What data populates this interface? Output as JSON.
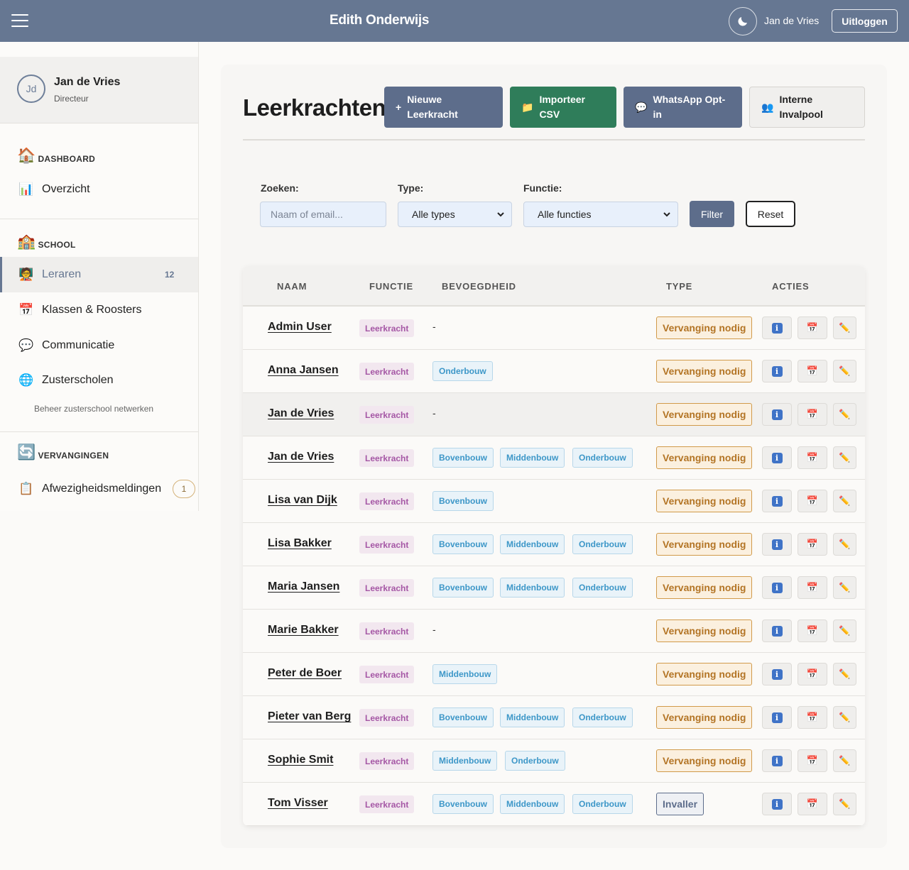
{
  "header": {
    "brand": "Edith Onderwijs",
    "user": "Jan de Vries",
    "logout": "Uitloggen"
  },
  "sidebar": {
    "profile": {
      "initials": "Jd",
      "name": "Jan de Vries",
      "role": "Directeur"
    },
    "sections": {
      "dashboard": "DASHBOARD",
      "school": "SCHOOL",
      "vervangingen": "VERVANGINGEN"
    },
    "items": {
      "overzicht": "Overzicht",
      "leraren": "Leraren",
      "leraren_count": "12",
      "klassen": "Klassen & Roosters",
      "communicatie": "Communicatie",
      "zusterscholen": "Zusterscholen",
      "zusterscholen_sub": "Beheer zusterschool netwerken",
      "afwezigheid": "Afwezigheidsmeldingen",
      "afwezigheid_count": "1"
    }
  },
  "main": {
    "title": "Leerkrachten",
    "actions": {
      "new_teacher": "Nieuwe Leerkracht",
      "import_csv": "Importeer CSV",
      "whatsapp": "WhatsApp Opt-in",
      "invalpool": "Interne Invalpool"
    },
    "filters": {
      "search_label": "Zoeken:",
      "search_placeholder": "Naam of email...",
      "type_label": "Type:",
      "type_value": "Alle types",
      "function_label": "Functie:",
      "function_value": "Alle functies",
      "filter_button": "Filter",
      "reset_button": "Reset"
    },
    "table": {
      "columns": [
        "NAAM",
        "FUNCTIE",
        "BEVOEGDHEID",
        "TYPE",
        "ACTIES"
      ],
      "rows": [
        {
          "name": "Admin User",
          "function": "Leerkracht",
          "qualifications": [],
          "type": "Vervanging nodig"
        },
        {
          "name": "Anna Jansen",
          "function": "Leerkracht",
          "qualifications": [
            "Onderbouw"
          ],
          "type": "Vervanging nodig"
        },
        {
          "name": "Jan de Vries",
          "function": "Leerkracht",
          "qualifications": [],
          "type": "Vervanging nodig"
        },
        {
          "name": "Jan de Vries",
          "function": "Leerkracht",
          "qualifications": [
            "Bovenbouw",
            "Middenbouw",
            "Onderbouw"
          ],
          "type": "Vervanging nodig"
        },
        {
          "name": "Lisa van Dijk",
          "function": "Leerkracht",
          "qualifications": [
            "Bovenbouw"
          ],
          "type": "Vervanging nodig"
        },
        {
          "name": "Lisa Bakker",
          "function": "Leerkracht",
          "qualifications": [
            "Bovenbouw",
            "Middenbouw",
            "Onderbouw"
          ],
          "type": "Vervanging nodig"
        },
        {
          "name": "Maria Jansen",
          "function": "Leerkracht",
          "qualifications": [
            "Bovenbouw",
            "Middenbouw",
            "Onderbouw"
          ],
          "type": "Vervanging nodig"
        },
        {
          "name": "Marie Bakker",
          "function": "Leerkracht",
          "qualifications": [],
          "type": "Vervanging nodig"
        },
        {
          "name": "Peter de Boer",
          "function": "Leerkracht",
          "qualifications": [
            "Middenbouw"
          ],
          "type": "Vervanging nodig"
        },
        {
          "name": "Pieter van Berg",
          "function": "Leerkracht",
          "qualifications": [
            "Bovenbouw",
            "Middenbouw",
            "Onderbouw"
          ],
          "type": "Vervanging nodig"
        },
        {
          "name": "Sophie Smit",
          "function": "Leerkracht",
          "qualifications": [
            "Middenbouw",
            "Onderbouw"
          ],
          "type": "Vervanging nodig"
        },
        {
          "name": "Tom Visser",
          "function": "Leerkracht",
          "qualifications": [
            "Bovenbouw",
            "Middenbouw",
            "Onderbouw"
          ],
          "type": "Invaller"
        }
      ],
      "empty_qualification": "-"
    }
  },
  "colors": {
    "header_bg": "#667792",
    "primary": "#5d6d8b",
    "success": "#2f7d5a",
    "function_badge": "#a557a5",
    "qualification_badge": "#3d97c8",
    "type_warning": "#b37424"
  },
  "icons": {
    "menu": "hamburger-icon",
    "theme": "moon-icon",
    "dashboard": "house-icon",
    "overview": "bar-chart-icon",
    "school": "school-building-icon",
    "teachers": "teacher-icon",
    "classes": "calendar-icon",
    "communication": "speech-bubble-icon",
    "sister_schools": "globe-icon",
    "replacements": "refresh-icon",
    "absence": "clipboard-icon",
    "row_actions": [
      "info-icon",
      "calendar-icon",
      "pencil-icon"
    ]
  }
}
